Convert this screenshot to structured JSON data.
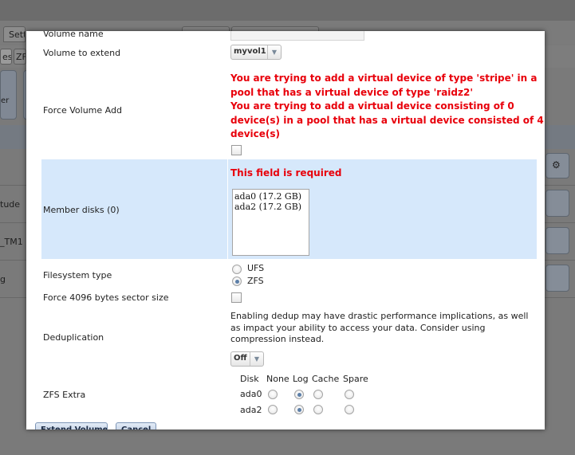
{
  "background": {
    "tabs": [
      "Sett"
    ],
    "left_chips": [
      "es",
      "ZF"
    ],
    "big_button_label": "er",
    "row_labels": [
      "tude",
      "_TM1",
      "g"
    ]
  },
  "form": {
    "volume_name_label": "Volume name",
    "volume_to_extend": {
      "label": "Volume to extend",
      "value": "myvol1"
    },
    "force_volume_add": {
      "label": "Force Volume Add",
      "errors": [
        "You are trying to add a virtual device of type 'stripe' in a",
        "pool that has a virtual device of type 'raidz2'",
        "You are trying to add a virtual device consisting of 0",
        "device(s) in a pool that has a virtual device consisted of 4",
        "device(s)"
      ],
      "checked": false
    },
    "member_disks": {
      "label": "Member disks (0)",
      "error": "This field is required",
      "options": [
        "ada0 (17.2 GB)",
        "ada2 (17.2 GB)"
      ]
    },
    "filesystem_type": {
      "label": "Filesystem type",
      "options": [
        "UFS",
        "ZFS"
      ],
      "selected": "ZFS"
    },
    "force_4096": {
      "label": "Force 4096 bytes sector size",
      "checked": false
    },
    "deduplication": {
      "label": "Deduplication",
      "note": "Enabling dedup may have drastic performance implications, as well as impact your ability to access your data. Consider using compression instead.",
      "value": "Off"
    },
    "zfs_extra": {
      "label": "ZFS Extra",
      "headers": [
        "Disk",
        "None",
        "Log",
        "Cache",
        "Spare"
      ],
      "rows": [
        {
          "disk": "ada0",
          "selected": "Log"
        },
        {
          "disk": "ada2",
          "selected": "Log"
        }
      ]
    },
    "buttons": {
      "extend": "Extend Volume",
      "cancel": "Cancel"
    }
  },
  "colors": {
    "error": "#e8000b",
    "highlight": "#d6e8fb",
    "radio_dot": "#5c7fa8"
  }
}
